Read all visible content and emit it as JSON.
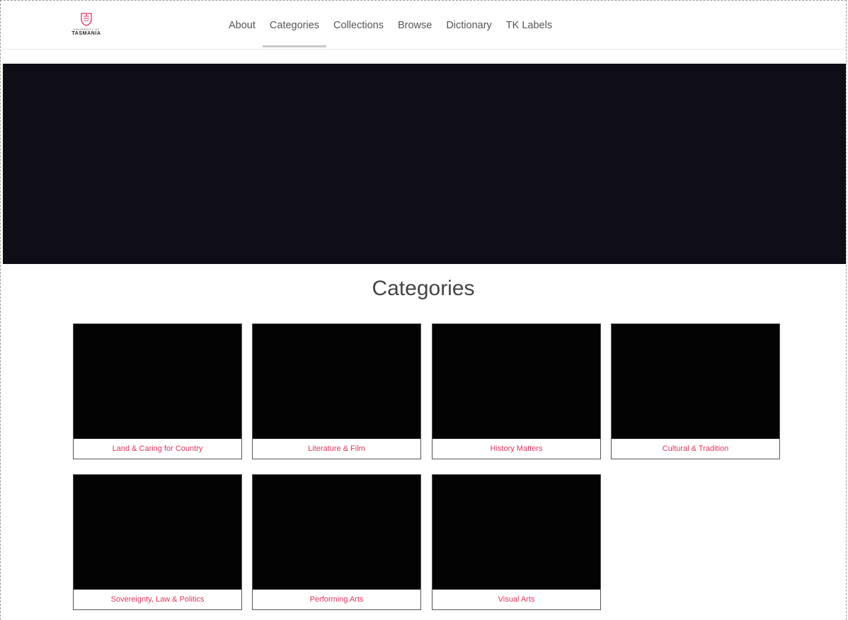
{
  "logo": {
    "small_text": "UNIVERSITY OF",
    "main_text": "TASMANIA",
    "accent_color": "#e5335f"
  },
  "nav": {
    "items": [
      {
        "label": "About",
        "active": false
      },
      {
        "label": "Categories",
        "active": true
      },
      {
        "label": "Collections",
        "active": false
      },
      {
        "label": "Browse",
        "active": false
      },
      {
        "label": "Dictionary",
        "active": false
      },
      {
        "label": "TK Labels",
        "active": false
      }
    ]
  },
  "main": {
    "title": "Categories",
    "categories": [
      {
        "label": "Land & Caring for Country"
      },
      {
        "label": "Literature & Film"
      },
      {
        "label": "History Matters"
      },
      {
        "label": "Cultural & Tradition"
      },
      {
        "label": "Sovereignty, Law & Politics"
      },
      {
        "label": "Performing Arts"
      },
      {
        "label": "Visual Arts"
      }
    ]
  },
  "colors": {
    "hero_background": "#0f0e16",
    "card_image": "#030303",
    "card_label": "#e5335f"
  }
}
